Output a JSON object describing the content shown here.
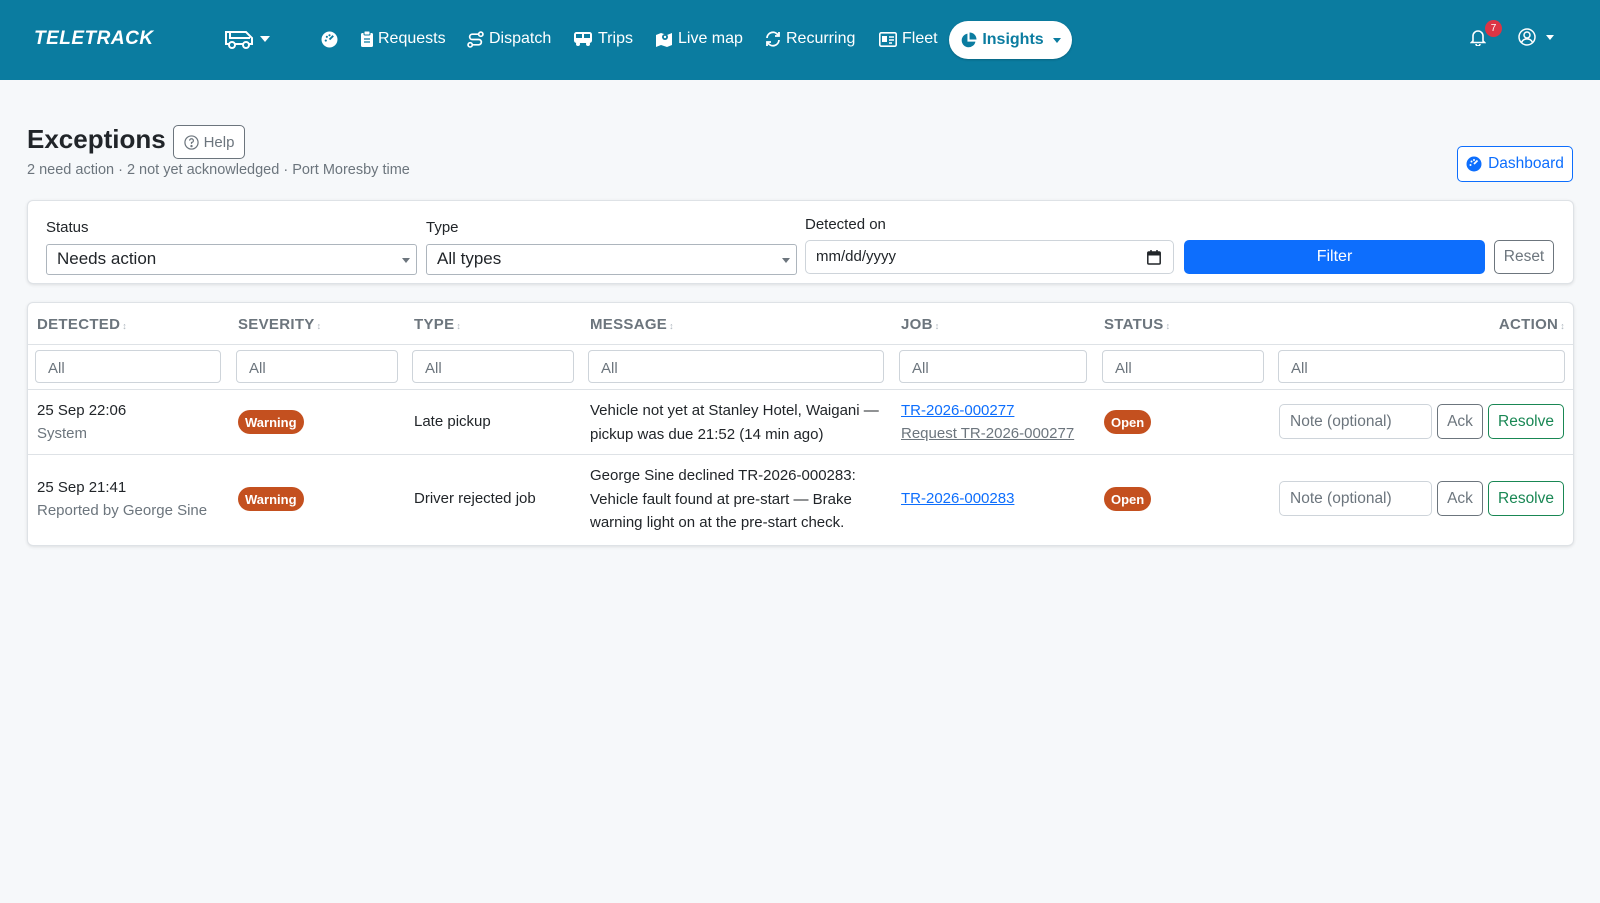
{
  "colors": {
    "navbar": "#0b7ca0",
    "primary": "#0d6efd",
    "success": "#198754",
    "warning_badge": "#c4501f",
    "open_badge": "#c4501f",
    "notification_badge": "#dc3545"
  },
  "navbar": {
    "brand": "TELETRACK",
    "vehicle_icon": "van-icon",
    "links": [
      {
        "label": "",
        "icon": "gauge-icon"
      },
      {
        "label": "Requests",
        "icon": "clipboard-icon"
      },
      {
        "label": "Dispatch",
        "icon": "route-icon"
      },
      {
        "label": "Trips",
        "icon": "bus-icon"
      },
      {
        "label": "Live map",
        "icon": "map-pin-icon"
      },
      {
        "label": "Recurring",
        "icon": "repeat-icon"
      },
      {
        "label": "Fleet",
        "icon": "id-card-icon"
      }
    ],
    "active": {
      "label": "Insights",
      "icon": "pie-chart-icon"
    },
    "notification_count": "7",
    "user_icon": "user-circle-icon"
  },
  "header": {
    "title": "Exceptions",
    "help_label": "Help",
    "subtitle": "2 need action · 2 not yet acknowledged · Port Moresby time",
    "dashboard_label": "Dashboard"
  },
  "filters": {
    "status_label": "Status",
    "status_value": "Needs action",
    "type_label": "Type",
    "type_value": "All types",
    "detected_label": "Detected on",
    "detected_placeholder": "mm/dd/yyyy",
    "filter_label": "Filter",
    "reset_label": "Reset"
  },
  "table": {
    "headers": [
      "DETECTED",
      "SEVERITY",
      "TYPE",
      "MESSAGE",
      "JOB",
      "STATUS",
      "ACTION"
    ],
    "column_filter_placeholder": "All",
    "rows": [
      {
        "detected": "25 Sep 22:06",
        "detected_by": "System",
        "severity": "Warning",
        "type": "Late pickup",
        "message": "Vehicle not yet at Stanley Hotel, Waigani — pickup was due 21:52 (14 min ago)",
        "job": "TR-2026-000277",
        "job_sub": "Request TR-2026-000277",
        "status": "Open",
        "note_placeholder": "Note (optional)",
        "ack_label": "Ack",
        "resolve_label": "Resolve"
      },
      {
        "detected": "25 Sep 21:41",
        "detected_by": "Reported by George Sine",
        "severity": "Warning",
        "type": "Driver rejected job",
        "message": "George Sine declined TR-2026-000283: Vehicle fault found at pre-start — Brake warning light on at the pre-start check.",
        "job": "TR-2026-000283",
        "job_sub": "",
        "status": "Open",
        "note_placeholder": "Note (optional)",
        "ack_label": "Ack",
        "resolve_label": "Resolve"
      }
    ]
  }
}
